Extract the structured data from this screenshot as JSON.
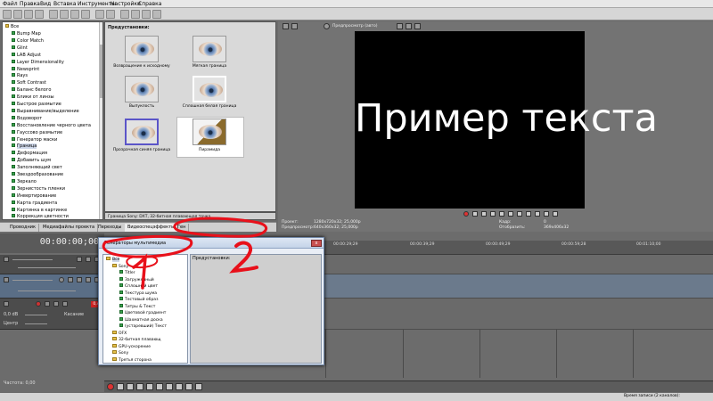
{
  "menu": [
    "Файл",
    "Правка",
    "Вид",
    "Вставка",
    "Инструменты",
    "Настройки",
    "Справка"
  ],
  "tree": {
    "root": "Все",
    "items": [
      "Bump Map",
      "Color Match",
      "Glint",
      "LAB Adjust",
      "Layer Dimensionality",
      "Newsprint",
      "Rays",
      "Soft Contrast",
      "Баланс белого",
      "Блики от линзы",
      "Быстрое размытие",
      "Выравнивание/выделение",
      "Водоворот",
      "Восстановление черного цвета",
      "Гауссово размытие",
      "Генератор маски",
      "Граница",
      "Деформация",
      "Добавить шум",
      "Заполняющий свет",
      "Звездообразование",
      "Зеркало",
      "Зернистость пленки",
      "Инвертирование",
      "Карта градиента",
      "Картинка в картинке",
      "Коррекция цветности"
    ],
    "selected_index": 16
  },
  "presets": {
    "title": "Предустановки:",
    "items": [
      "Возвращение к исходному",
      "Мягкая граница",
      "Выпуклость",
      "Сплошная белая граница",
      "Прозрачная синяя граница",
      "Пирамида"
    ],
    "selected_index": 5,
    "description": "Граница Sony: DXT, 32-битная плавающая точка"
  },
  "tabs": [
    "Проводник",
    "Медиафайлы проекта",
    "Переходы",
    "Видеоспецэффекты",
    "Ген"
  ],
  "active_tab": 3,
  "preview": {
    "mode": "Предпросмотр (авто)",
    "overlay_text": "Пример текста",
    "project_label": "Проект:",
    "project_value": "1280x720x32; 25,000p",
    "preview_label": "Предпросмотр:",
    "preview_value": "640x360x32; 25,000p",
    "frame_label": "Кадр:",
    "frame_value": "0",
    "display_label": "Отобразить:",
    "display_value": "369x406x32"
  },
  "timeline": {
    "timecode": "00:00:00;00",
    "ruler": [
      "00:00:00;00",
      "00:00:09;29",
      "00:00:19;29",
      "00:00:29;29",
      "00:00:39;29",
      "00:00:49;29",
      "00:00:59;28",
      "00:01:10;00",
      "00:01:20;00"
    ],
    "audio_level": "0,0 dB",
    "pan_label": "Центр",
    "touch_label": "Касание",
    "track_badge": "0,4",
    "rate": "Частота: 0,00",
    "record_time": "Время записи (2 каналов):"
  },
  "dialog": {
    "title": "Генераторы мультимедиа",
    "close": "x",
    "presets_label": "Предустановки:",
    "tree": [
      {
        "label": "Все",
        "kind": "folder",
        "selected": true
      },
      {
        "label": "Sony",
        "kind": "folder"
      },
      {
        "label": "Titler",
        "kind": "fx"
      },
      {
        "label": "Загруженный",
        "kind": "fx"
      },
      {
        "label": "Сплошной цвет",
        "kind": "fx"
      },
      {
        "label": "Текстура шума",
        "kind": "fx"
      },
      {
        "label": "Тестовый образ",
        "kind": "fx"
      },
      {
        "label": "Титры & Текст",
        "kind": "fx"
      },
      {
        "label": "Цветовой градиент",
        "kind": "fx"
      },
      {
        "label": "Шахматная доска",
        "kind": "fx"
      },
      {
        "label": "(устаревший) Текст",
        "kind": "fx"
      },
      {
        "label": "OFX",
        "kind": "folder"
      },
      {
        "label": "32-битная плавающ",
        "kind": "folder"
      },
      {
        "label": "GPU-ускорение",
        "kind": "folder"
      },
      {
        "label": "Sony",
        "kind": "folder"
      },
      {
        "label": "Третья сторона",
        "kind": "folder"
      }
    ]
  },
  "annotations": [
    "1",
    "2"
  ],
  "colors": {
    "annotation": "#e8101a",
    "selection": "#cfd8ea",
    "dialog_border": "#6f86a7"
  }
}
